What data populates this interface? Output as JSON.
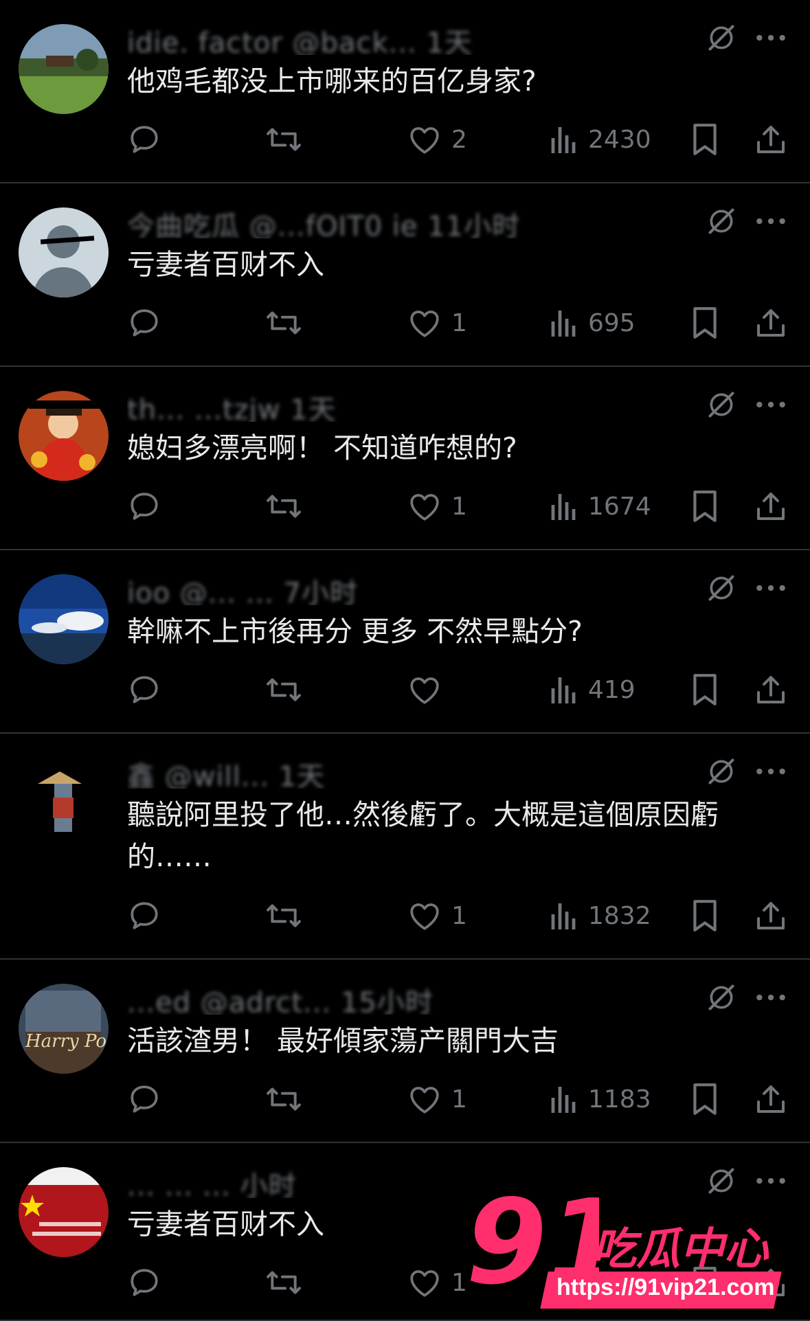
{
  "replies": [
    {
      "handle": "idie. factor @back...  1天",
      "text": "他鸡毛都没上市哪来的百亿身家?",
      "likes": "2",
      "views": "2430",
      "avatar": "landscape"
    },
    {
      "handle": "今曲吃瓜 @...fOIT0 ie  11小时",
      "text": "亏妻者百财不入",
      "likes": "1",
      "views": "695",
      "avatar": "default"
    },
    {
      "handle": "th... ...tzjw  1天",
      "text": "媳妇多漂亮啊！ 不知道咋想的?",
      "likes": "1",
      "views": "1674",
      "avatar": "god-of-wealth"
    },
    {
      "handle": "ioo @... ...  7小时",
      "text": "幹嘛不上市後再分 更多 不然早點分?",
      "likes": "",
      "views": "419",
      "avatar": "sky"
    },
    {
      "handle": "鑫 @will...  1天",
      "text": "聽說阿里投了他…然後虧了。大概是這個原因虧\n的……",
      "likes": "1",
      "views": "1832",
      "avatar": "figure"
    },
    {
      "handle": "...ed @adrct...  15小时",
      "text": "活該渣男！ 最好傾家蕩产關門大吉",
      "likes": "1",
      "views": "1183",
      "avatar": "harry-potter"
    },
    {
      "handle": "...  ... ...  小时",
      "text": "亏妻者百财不入",
      "likes": "1",
      "views": "",
      "avatar": "flag"
    }
  ],
  "icons": {
    "reply": "reply-icon",
    "repost": "repost-icon",
    "like": "heart-icon",
    "views": "views-icon",
    "bookmark": "bookmark-icon",
    "share": "share-icon",
    "grok": "grok-icon",
    "more": "more-icon"
  },
  "watermark": {
    "logo": "91",
    "brand": "吃瓜中心",
    "url": "https://91vip21.com"
  },
  "colors": {
    "background": "#000000",
    "text": "#e7e9ea",
    "muted": "#71767b",
    "divider": "#2f3336",
    "watermark": "#ff2e6d"
  }
}
